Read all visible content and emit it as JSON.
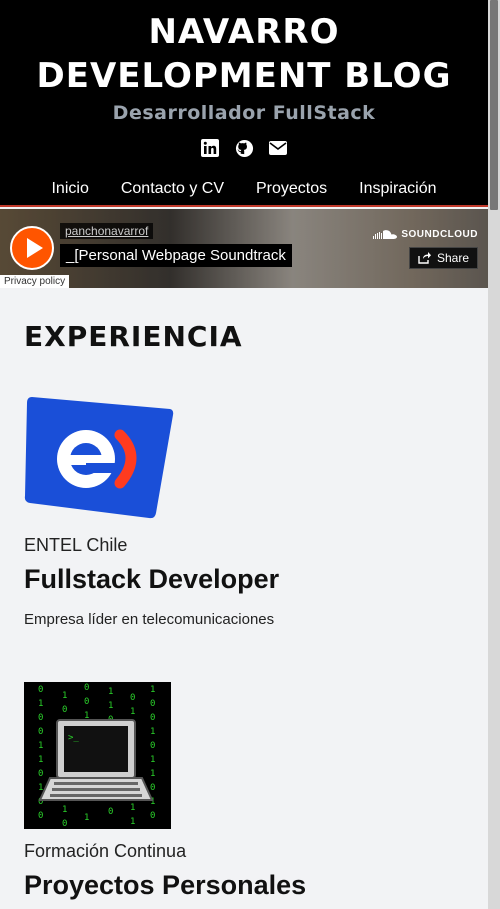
{
  "header": {
    "title_line1": "NAVARRO",
    "title_line2": "DEVELOPMENT BLOG",
    "subtitle": "Desarrollador FullStack",
    "social_icons": [
      "linkedin-icon",
      "github-icon",
      "envelope-icon"
    ]
  },
  "nav": {
    "items": [
      "Inicio",
      "Contacto y CV",
      "Proyectos",
      "Inspiración"
    ]
  },
  "player": {
    "uploader": "panchonavarrof",
    "track": "_[Personal Webpage Soundtrack",
    "brand": "SOUNDCLOUD",
    "share_label": "Share",
    "privacy": "Privacy policy",
    "accent": "#ff5500"
  },
  "experience": {
    "heading": "EXPERIENCIA",
    "items": [
      {
        "company": "ENTEL Chile",
        "role": "Fullstack Developer",
        "description": "Empresa líder en telecomunicaciones",
        "logo": "entel-logo"
      },
      {
        "company": "Formación Continua",
        "role": "Proyectos Personales",
        "logo": "laptop-terminal-logo"
      }
    ]
  },
  "colors": {
    "header_bg": "#000000",
    "page_bg": "#f2f3f5",
    "entel_blue": "#1a4fd8",
    "entel_red": "#ff3b1f"
  }
}
